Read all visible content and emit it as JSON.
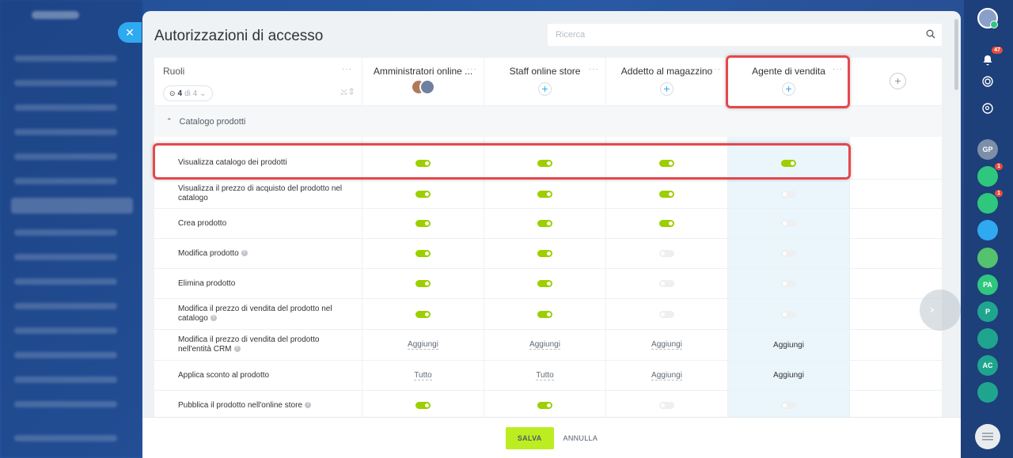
{
  "panel": {
    "title": "Autorizzazioni di accesso",
    "search_placeholder": "Ricerca"
  },
  "roles_column": {
    "label": "Ruoli",
    "counter_value": "4",
    "counter_suffix": "di 4"
  },
  "roles": [
    {
      "name": "Amministratori online ...",
      "has_members": true
    },
    {
      "name": "Staff online store",
      "has_members": false
    },
    {
      "name": "Addetto al magazzino",
      "has_members": false
    },
    {
      "name": "Agente di vendita",
      "has_members": false
    }
  ],
  "section": {
    "title": "Catalogo prodotti",
    "expanded": true
  },
  "permissions": [
    {
      "name": "Visualizza catalogo dei prodotti",
      "help": false,
      "values": [
        [
          "toggle",
          "on"
        ],
        [
          "toggle",
          "on"
        ],
        [
          "toggle",
          "on"
        ],
        [
          "toggle",
          "on"
        ]
      ]
    },
    {
      "name": "Visualizza il prezzo di acquisto del prodotto nel catalogo",
      "help": false,
      "values": [
        [
          "toggle",
          "on"
        ],
        [
          "toggle",
          "on"
        ],
        [
          "toggle",
          "on"
        ],
        [
          "toggle",
          "off"
        ]
      ]
    },
    {
      "name": "Crea prodotto",
      "help": false,
      "values": [
        [
          "toggle",
          "on"
        ],
        [
          "toggle",
          "on"
        ],
        [
          "toggle",
          "on"
        ],
        [
          "toggle",
          "off"
        ]
      ]
    },
    {
      "name": "Modifica prodotto",
      "help": true,
      "values": [
        [
          "toggle",
          "on"
        ],
        [
          "toggle",
          "on"
        ],
        [
          "toggle",
          "off"
        ],
        [
          "toggle",
          "off"
        ]
      ]
    },
    {
      "name": "Elimina prodotto",
      "help": false,
      "values": [
        [
          "toggle",
          "on"
        ],
        [
          "toggle",
          "on"
        ],
        [
          "toggle",
          "off"
        ],
        [
          "toggle",
          "off"
        ]
      ]
    },
    {
      "name": "Modifica il prezzo di vendita del prodotto nel catalogo",
      "help": true,
      "values": [
        [
          "toggle",
          "on"
        ],
        [
          "toggle",
          "on"
        ],
        [
          "toggle",
          "off"
        ],
        [
          "toggle",
          "off"
        ]
      ]
    },
    {
      "name": "Modifica il prezzo di vendita del prodotto nell'entità CRM",
      "help": true,
      "values": [
        [
          "link",
          "Aggiungi"
        ],
        [
          "link",
          "Aggiungi"
        ],
        [
          "link",
          "Aggiungi"
        ],
        [
          "text",
          "Aggiungi"
        ]
      ]
    },
    {
      "name": "Applica sconto al prodotto",
      "help": false,
      "values": [
        [
          "link",
          "Tutto"
        ],
        [
          "link",
          "Tutto"
        ],
        [
          "link",
          "Aggiungi"
        ],
        [
          "text",
          "Aggiungi"
        ]
      ]
    },
    {
      "name": "Pubblica il prodotto nell'online store",
      "help": true,
      "values": [
        [
          "toggle",
          "on"
        ],
        [
          "toggle",
          "on"
        ],
        [
          "toggle",
          "off"
        ],
        [
          "toggle",
          "off"
        ]
      ]
    }
  ],
  "footer": {
    "save_label": "SALVA",
    "cancel_label": "ANNULLA"
  },
  "rail": {
    "notifications_count": "47",
    "items": [
      {
        "initials": "GP",
        "color": "#7c8ea8"
      },
      {
        "initials": "",
        "color": "#2fc67d",
        "badge": "1"
      },
      {
        "initials": "",
        "color": "#2fc67d",
        "badge": "1"
      },
      {
        "initials": "",
        "color": "#2fa9f0"
      },
      {
        "initials": "",
        "color": "#55c26e"
      },
      {
        "initials": "PA",
        "color": "#2fc67d"
      },
      {
        "initials": "P",
        "color": "#1fa58e"
      },
      {
        "initials": "",
        "color": "#1fa58e"
      },
      {
        "initials": "AC",
        "color": "#1fa58e"
      },
      {
        "initials": "",
        "color": "#1fa58e"
      }
    ]
  },
  "colors": {
    "toggle_on": "#9dcf00",
    "toggle_off": "#edeff1",
    "highlight_column": "#eaf6fc",
    "save_button": "#bbed21",
    "annotation_red": "#e5484d",
    "accent_blue": "#2fa9f0"
  }
}
